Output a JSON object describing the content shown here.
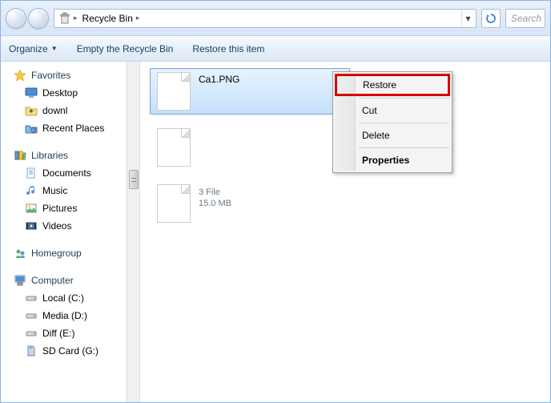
{
  "address": {
    "location": "Recycle Bin"
  },
  "toolbar": {
    "organize": "Organize",
    "empty": "Empty the Recycle Bin",
    "restore": "Restore this item"
  },
  "search": {
    "placeholder": "Search"
  },
  "nav": {
    "favorites": {
      "label": "Favorites",
      "items": [
        "Desktop",
        "downl",
        "Recent Places"
      ]
    },
    "libraries": {
      "label": "Libraries",
      "items": [
        "Documents",
        "Music",
        "Pictures",
        "Videos"
      ]
    },
    "homegroup": {
      "label": "Homegroup"
    },
    "computer": {
      "label": "Computer",
      "items": [
        "Local (C:)",
        "Media (D:)",
        "Diff (E:)",
        "SD Card (G:)"
      ]
    }
  },
  "files": [
    {
      "name": "Ca1.PNG",
      "sub1": "",
      "sub2": ""
    },
    {
      "name": "",
      "sub1": "",
      "sub2": ""
    },
    {
      "name": "",
      "sub1": "3 File",
      "sub2": "15.0 MB"
    }
  ],
  "contextMenu": {
    "restore": "Restore",
    "cut": "Cut",
    "delete": "Delete",
    "properties": "Properties"
  }
}
